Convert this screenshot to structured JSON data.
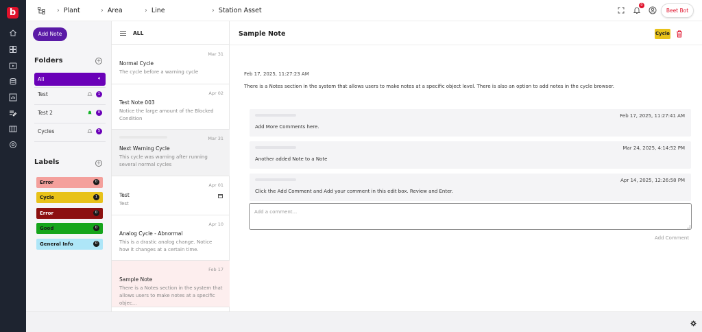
{
  "app": {
    "logo_text": "b",
    "brand_color": "#e0112b"
  },
  "rail": {
    "icons": [
      "home-icon",
      "dashboard-icon",
      "video-icon",
      "database-icon",
      "chart-icon",
      "notes-icon",
      "columns-icon",
      "settings-icon"
    ]
  },
  "topbar": {
    "breadcrumbs": [
      "Plant",
      "Area",
      "Line",
      "Station Asset"
    ],
    "notification_count": "0",
    "user_label": "Beet Bot"
  },
  "folders_panel": {
    "add_note_label": "Add Note",
    "folders_title": "Folders",
    "folders": [
      {
        "name": "All",
        "count": "4",
        "selected": true
      },
      {
        "name": "Test",
        "count": "1",
        "bell": "outline"
      },
      {
        "name": "Test 2",
        "count": "0",
        "bell": "green"
      },
      {
        "name": "Cycles",
        "count": "5",
        "bell": "outline"
      }
    ],
    "labels_title": "Labels",
    "labels": [
      {
        "name": "Error",
        "count": "0",
        "bg": "#f4a09c",
        "fg": "#1a1a1a"
      },
      {
        "name": "Cycle",
        "count": "1",
        "bg": "#e8c21a",
        "fg": "#1a1a1a"
      },
      {
        "name": "Error",
        "count": "0",
        "bg": "#8c1010",
        "fg": "#ffffff"
      },
      {
        "name": "Good",
        "count": "0",
        "bg": "#16a51c",
        "fg": "#1a1a1a"
      },
      {
        "name": "General Info",
        "count": "0",
        "bg": "#aee6f8",
        "fg": "#1a1a1a"
      }
    ]
  },
  "notes_list": {
    "header": "ALL",
    "items": [
      {
        "date": "Mar 31",
        "title": "Normal Cycle",
        "preview": "The cycle before a warning cycle"
      },
      {
        "date": "Apr 02",
        "title": "Test Note 003",
        "preview": "Notice the large amount of the Blocked Condition"
      },
      {
        "date": "Mar 31",
        "title": "Next Warning Cycle",
        "preview": "This cycle was warning after running several normal cycles"
      },
      {
        "date": "Apr 01",
        "title": "Test",
        "preview": "Test"
      },
      {
        "date": "Apr 10",
        "title": "Analog Cycle - Abnormal",
        "preview": "This is a drastic analog change. Notice how it changes at a certain time."
      },
      {
        "date": "Feb 17",
        "title": "Sample Note",
        "preview": "There is a Notes section in the system that allows users to make notes at a specific objec..."
      }
    ]
  },
  "detail": {
    "title": "Sample Note",
    "tag": "Cycle",
    "timestamp": "Feb 17, 2025, 11:27:23 AM",
    "body": "There is a Notes section in the system that allows users to make notes at a specific object level. There is also an option to add notes in the cycle browser.",
    "comments": [
      {
        "date": "Feb 17, 2025, 11:27:41 AM",
        "text": "Add More Comments here."
      },
      {
        "date": "Mar 24, 2025, 4:14:52 PM",
        "text": "Another added Note to a Note"
      },
      {
        "date": "Apr 14, 2025, 12:26:58 PM",
        "text": "Click the Add Comment and Add your comment in this edit box. Review and Enter."
      }
    ],
    "comment_placeholder": "Add a comment...",
    "add_comment_label": "Add Comment"
  }
}
